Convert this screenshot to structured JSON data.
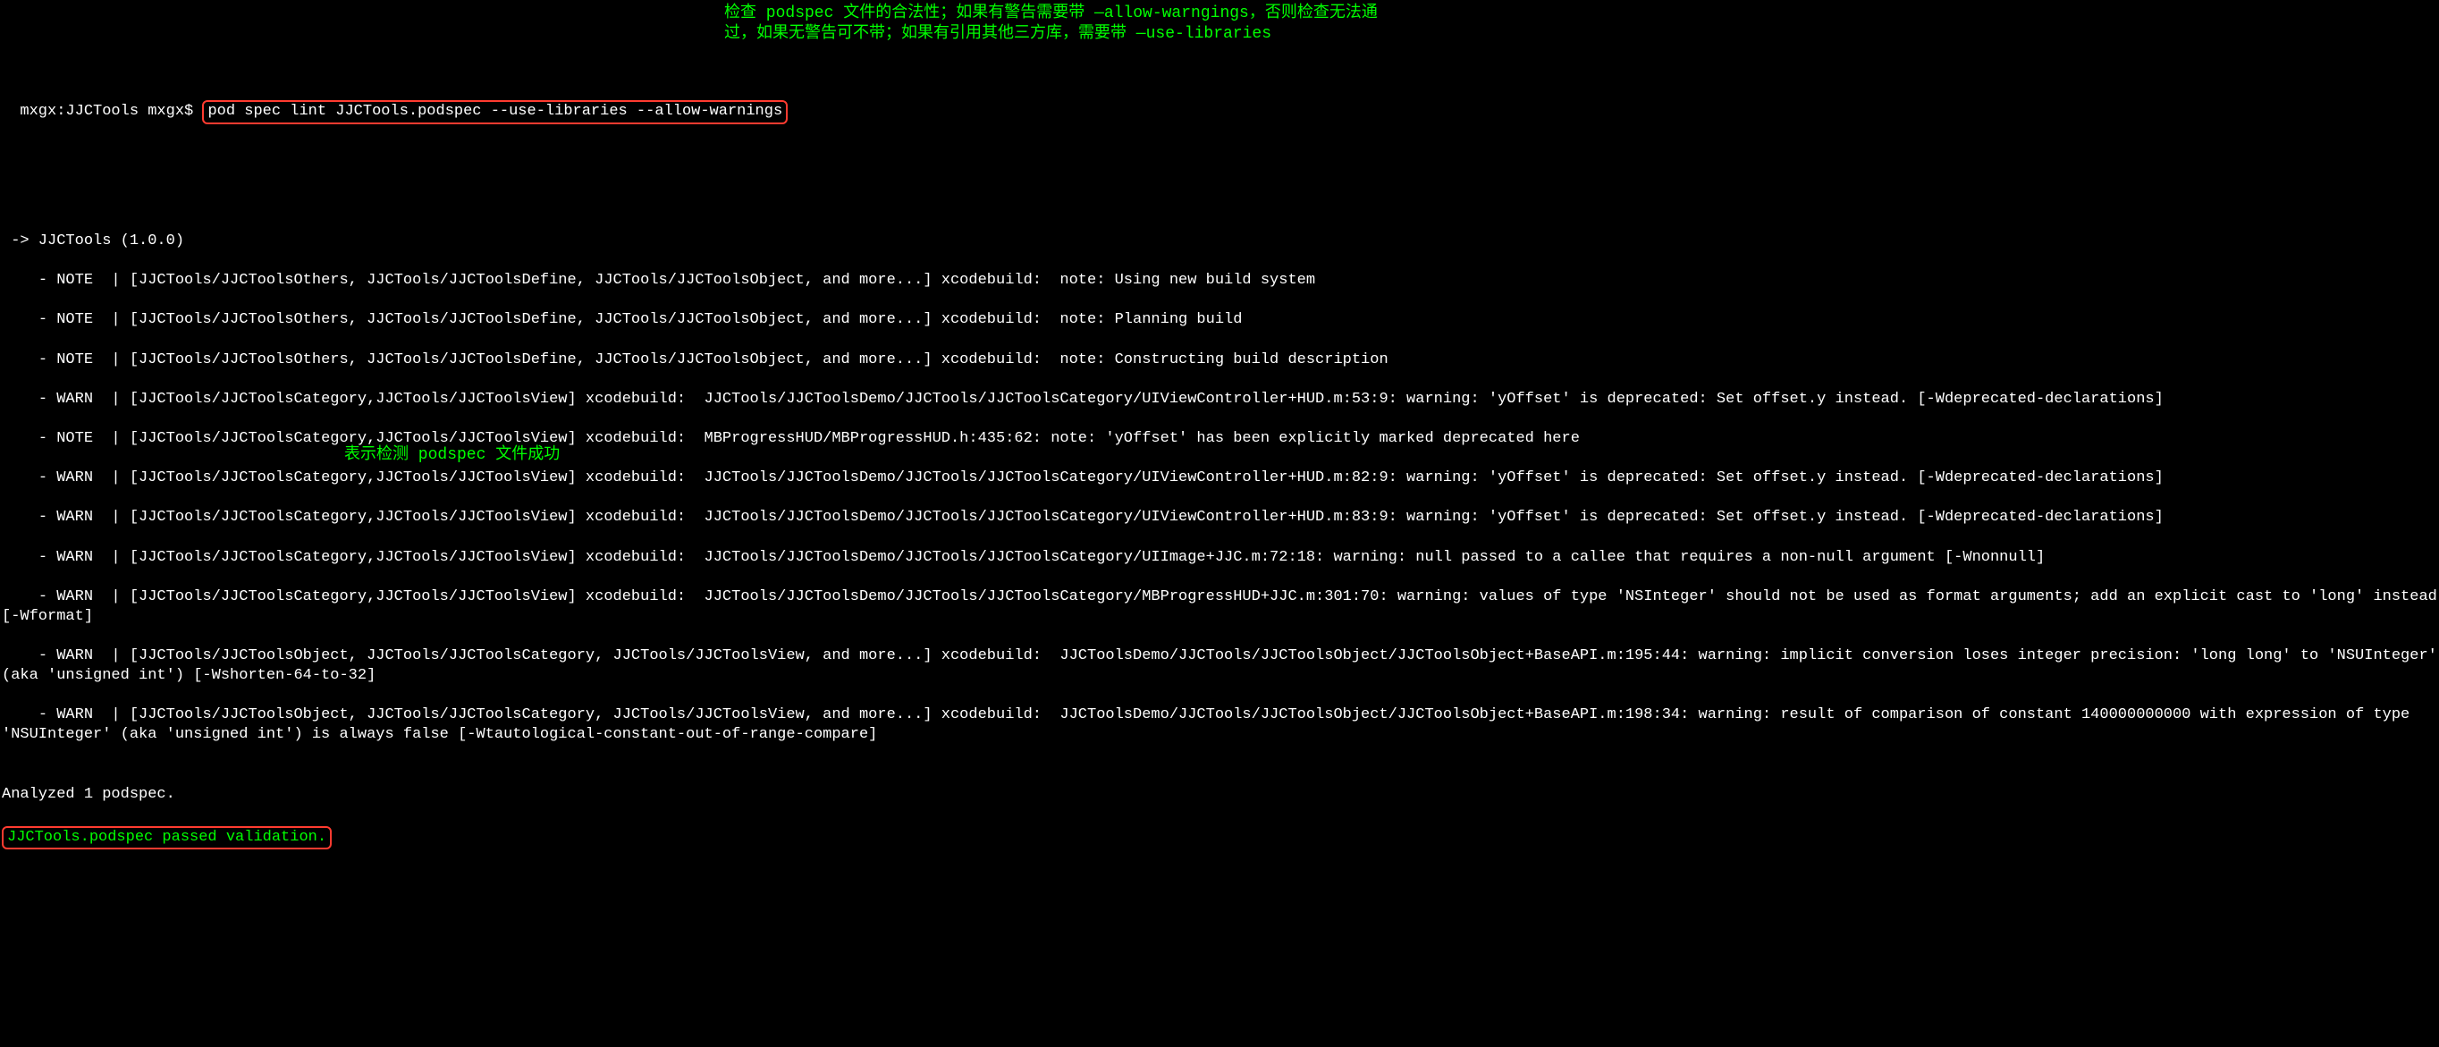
{
  "prompt": "mxgx:JJCTools mxgx$ ",
  "command": "pod spec lint JJCTools.podspec --use-libraries --allow-warnings",
  "annotation1": "检查 podspec 文件的合法性；如果有警告需要带 —allow-warngings，否则检查无法通过，如果无警告可不带；如果有引用其他三方库，需要带 —use-libraries",
  "annotation2": "表示检测 podspec 文件成功",
  "output": {
    "header": " -> JJCTools (1.0.0)",
    "lines": [
      "    - NOTE  | [JJCTools/JJCToolsOthers, JJCTools/JJCToolsDefine, JJCTools/JJCToolsObject, and more...] xcodebuild:  note: Using new build system",
      "    - NOTE  | [JJCTools/JJCToolsOthers, JJCTools/JJCToolsDefine, JJCTools/JJCToolsObject, and more...] xcodebuild:  note: Planning build",
      "    - NOTE  | [JJCTools/JJCToolsOthers, JJCTools/JJCToolsDefine, JJCTools/JJCToolsObject, and more...] xcodebuild:  note: Constructing build description",
      "    - WARN  | [JJCTools/JJCToolsCategory,JJCTools/JJCToolsView] xcodebuild:  JJCTools/JJCToolsDemo/JJCTools/JJCToolsCategory/UIViewController+HUD.m:53:9: warning: 'yOffset' is deprecated: Set offset.y instead. [-Wdeprecated-declarations]",
      "    - NOTE  | [JJCTools/JJCToolsCategory,JJCTools/JJCToolsView] xcodebuild:  MBProgressHUD/MBProgressHUD.h:435:62: note: 'yOffset' has been explicitly marked deprecated here",
      "    - WARN  | [JJCTools/JJCToolsCategory,JJCTools/JJCToolsView] xcodebuild:  JJCTools/JJCToolsDemo/JJCTools/JJCToolsCategory/UIViewController+HUD.m:82:9: warning: 'yOffset' is deprecated: Set offset.y instead. [-Wdeprecated-declarations]",
      "    - WARN  | [JJCTools/JJCToolsCategory,JJCTools/JJCToolsView] xcodebuild:  JJCTools/JJCToolsDemo/JJCTools/JJCToolsCategory/UIViewController+HUD.m:83:9: warning: 'yOffset' is deprecated: Set offset.y instead. [-Wdeprecated-declarations]",
      "    - WARN  | [JJCTools/JJCToolsCategory,JJCTools/JJCToolsView] xcodebuild:  JJCTools/JJCToolsDemo/JJCTools/JJCToolsCategory/UIImage+JJC.m:72:18: warning: null passed to a callee that requires a non-null argument [-Wnonnull]",
      "    - WARN  | [JJCTools/JJCToolsCategory,JJCTools/JJCToolsView] xcodebuild:  JJCTools/JJCToolsDemo/JJCTools/JJCToolsCategory/MBProgressHUD+JJC.m:301:70: warning: values of type 'NSInteger' should not be used as format arguments; add an explicit cast to 'long' instead [-Wformat]",
      "    - WARN  | [JJCTools/JJCToolsObject, JJCTools/JJCToolsCategory, JJCTools/JJCToolsView, and more...] xcodebuild:  JJCToolsDemo/JJCTools/JJCToolsObject/JJCToolsObject+BaseAPI.m:195:44: warning: implicit conversion loses integer precision: 'long long' to 'NSUInteger' (aka 'unsigned int') [-Wshorten-64-to-32]",
      "    - WARN  | [JJCTools/JJCToolsObject, JJCTools/JJCToolsCategory, JJCTools/JJCToolsView, and more...] xcodebuild:  JJCToolsDemo/JJCTools/JJCToolsObject/JJCToolsObject+BaseAPI.m:198:34: warning: result of comparison of constant 140000000000 with expression of type 'NSUInteger' (aka 'unsigned int') is always false [-Wtautological-constant-out-of-range-compare]"
    ],
    "analyzed": "Analyzed 1 podspec.",
    "passed": "JJCTools.podspec passed validation."
  }
}
